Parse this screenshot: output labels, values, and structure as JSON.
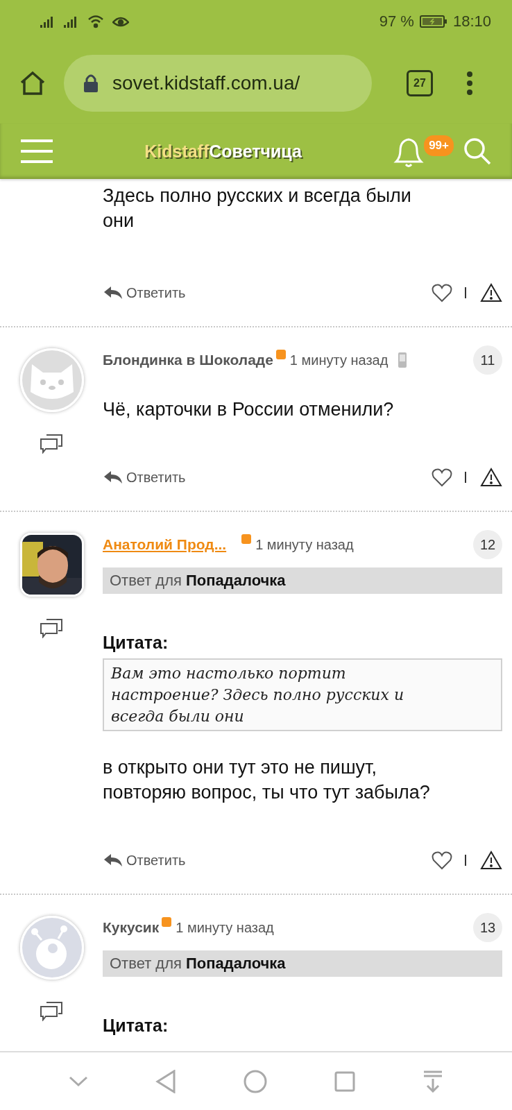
{
  "status_bar": {
    "battery": "97 %",
    "time": "18:10"
  },
  "browser": {
    "url": "sovet.kidstaff.com.ua/",
    "tab_count": "27"
  },
  "site_header": {
    "logo_part_1": "Kidstaff",
    "logo_part_2": "Советчица",
    "notification_badge": "99+"
  },
  "comments": [
    {
      "kind": "partial",
      "body": [
        "Здесь полно русских и всегда были",
        "они"
      ],
      "reply_label": "Ответить"
    },
    {
      "kind": "full",
      "avatar": {
        "kind": "cat"
      },
      "author": "Блондинка в Шоколаде",
      "author_link": false,
      "online": true,
      "time": "1 минуту назад",
      "mobile": true,
      "number": "11",
      "body": [
        "Чё, карточки в России отменили?"
      ],
      "reply_label": "Ответить"
    },
    {
      "kind": "full",
      "avatar": {
        "kind": "picture"
      },
      "author": "Анатолий Прод...",
      "author_link": true,
      "online": true,
      "time": "1 минуту назад",
      "mobile": false,
      "number": "12",
      "reply_to": "Ответ для **Попадалочка**",
      "quote_label": "Цитата:",
      "quote": [
        "Вам это настолько портит",
        "настроение? Здесь полно русских и",
        "всегда были они"
      ],
      "body": [
        "в открыто они тут это не пишут,",
        "повторяю вопрос, ты что тут забыла?"
      ],
      "reply_label": "Ответить"
    },
    {
      "kind": "full",
      "avatar": {
        "kind": "alien"
      },
      "author": "Кукусик",
      "author_link": false,
      "online": true,
      "time": "1 минуту назад",
      "mobile": false,
      "number": "13",
      "reply_to": "Ответ для **Попадалочка**",
      "quote_label": "Цитата:"
    }
  ]
}
